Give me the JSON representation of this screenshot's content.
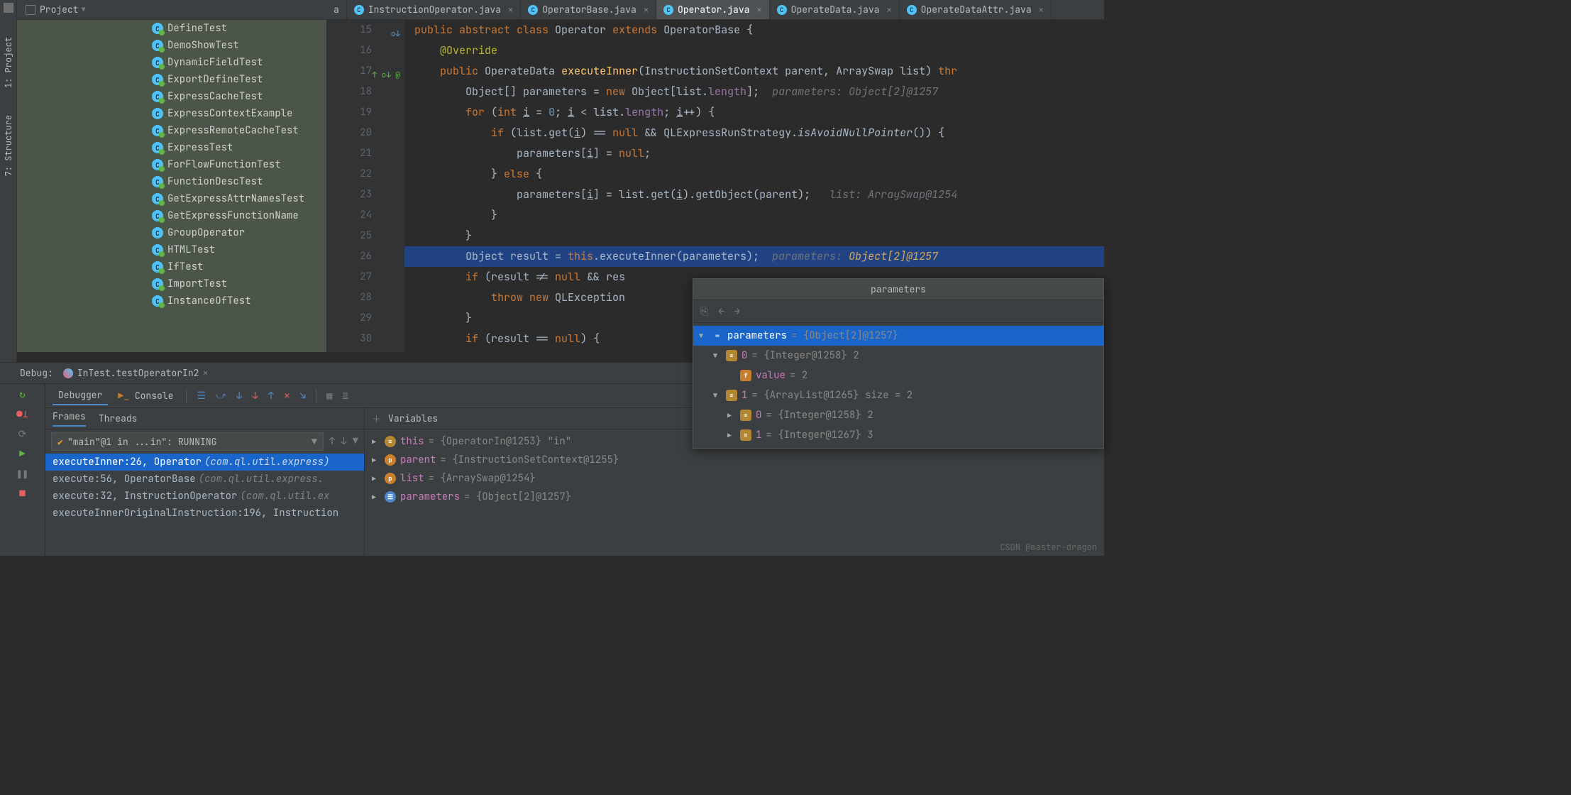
{
  "leftRail": {
    "project": "1: Project",
    "structure": "7: Structure"
  },
  "topBar": {
    "projectLabel": "Project"
  },
  "projectTree": [
    {
      "name": "DefineTest",
      "plain": false
    },
    {
      "name": "DemoShowTest",
      "plain": false
    },
    {
      "name": "DynamicFieldTest",
      "plain": false
    },
    {
      "name": "ExportDefineTest",
      "plain": false
    },
    {
      "name": "ExpressCacheTest",
      "plain": false
    },
    {
      "name": "ExpressContextExample",
      "plain": true
    },
    {
      "name": "ExpressRemoteCacheTest",
      "plain": false
    },
    {
      "name": "ExpressTest",
      "plain": false
    },
    {
      "name": "ForFlowFunctionTest",
      "plain": false
    },
    {
      "name": "FunctionDescTest",
      "plain": false
    },
    {
      "name": "GetExpressAttrNamesTest",
      "plain": false
    },
    {
      "name": "GetExpressFunctionName",
      "plain": false
    },
    {
      "name": "GroupOperator",
      "plain": true
    },
    {
      "name": "HTMLTest",
      "plain": false
    },
    {
      "name": "IfTest",
      "plain": false
    },
    {
      "name": "ImportTest",
      "plain": false
    },
    {
      "name": "InstanceOfTest",
      "plain": false
    }
  ],
  "editorTabs": [
    {
      "name": "a",
      "icon": false,
      "closable": false
    },
    {
      "name": "InstructionOperator.java",
      "icon": true,
      "closable": true
    },
    {
      "name": "OperatorBase.java",
      "icon": true,
      "closable": true
    },
    {
      "name": "Operator.java",
      "icon": true,
      "closable": true,
      "active": true
    },
    {
      "name": "OperateData.java",
      "icon": true,
      "closable": true
    },
    {
      "name": "OperateDataAttr.java",
      "icon": true,
      "closable": true
    }
  ],
  "code": {
    "startLine": 15,
    "breakpointLine": 26,
    "inlineHints": {
      "l18": "parameters: Object[2]@1257",
      "l23": "list: ArraySwap@1254",
      "l26": "parameters: Object[2]@1257"
    }
  },
  "varPopup": {
    "title": "parameters",
    "rows": [
      {
        "lvl": 0,
        "exp": "▼",
        "ic": "inf",
        "name": "parameters",
        "val": "= {Object[2]@1257}",
        "sel": true
      },
      {
        "lvl": 1,
        "exp": "▼",
        "ic": "el",
        "name": "0",
        "val": "= {Integer@1258} 2"
      },
      {
        "lvl": 2,
        "exp": "",
        "ic": "f",
        "name": "value",
        "val": "= 2"
      },
      {
        "lvl": 1,
        "exp": "▼",
        "ic": "el",
        "name": "1",
        "val": "= {ArrayList@1265}  size = 2"
      },
      {
        "lvl": 2,
        "exp": "▶",
        "ic": "el",
        "name": "0",
        "val": "= {Integer@1258} 2"
      },
      {
        "lvl": 2,
        "exp": "▶",
        "ic": "el",
        "name": "1",
        "val": "= {Integer@1267} 3"
      }
    ]
  },
  "debug": {
    "label": "Debug:",
    "session": "InTest.testOperatorIn2",
    "tabs": {
      "debugger": "Debugger",
      "console": "Console"
    },
    "framesTabs": {
      "frames": "Frames",
      "threads": "Threads"
    },
    "thread": "\"main\"@1 in ...in\": RUNNING",
    "frames": [
      {
        "m": "executeInner:26, Operator",
        "p": "(com.ql.util.express)",
        "sel": true
      },
      {
        "m": "execute:56, OperatorBase",
        "p": "(com.ql.util.express.",
        "sel": false
      },
      {
        "m": "execute:32, InstructionOperator",
        "p": "(com.ql.util.ex",
        "sel": false
      },
      {
        "m": "executeInnerOriginalInstruction:196, Instruction",
        "p": "",
        "sel": false
      }
    ],
    "variablesLabel": "Variables",
    "variables": [
      {
        "ic": "o",
        "name": "this",
        "val": "= {OperatorIn@1253} \"in\""
      },
      {
        "ic": "p",
        "name": "parent",
        "val": "= {InstructionSetContext@1255}"
      },
      {
        "ic": "p",
        "name": "list",
        "val": "= {ArraySwap@1254}"
      },
      {
        "ic": "b",
        "name": "parameters",
        "val": "= {Object[2]@1257}"
      }
    ]
  },
  "watermark": "CSDN @master-dragon"
}
